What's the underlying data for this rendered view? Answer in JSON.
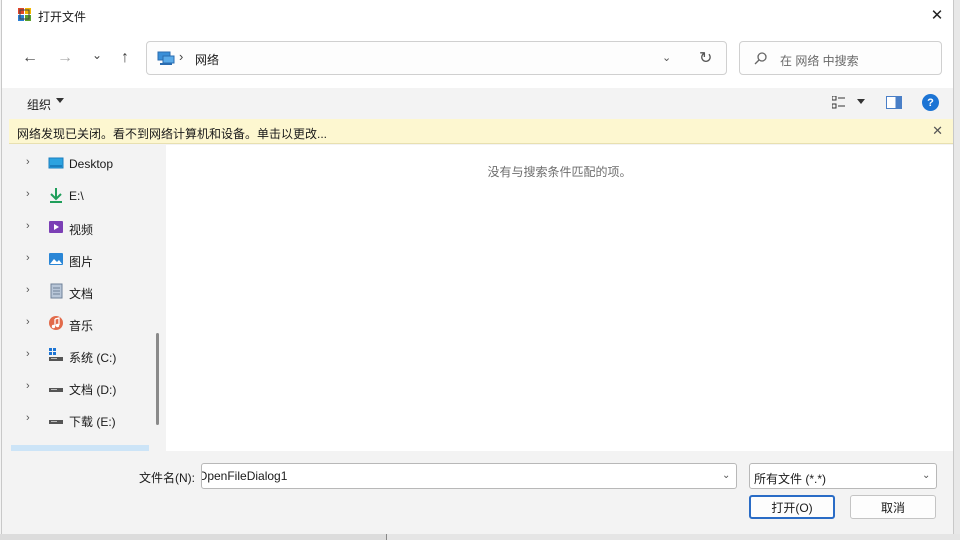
{
  "window": {
    "title": "打开文件",
    "close_glyph": "✕"
  },
  "nav": {
    "back_glyph": "←",
    "forward_glyph": "→",
    "recent_glyph": "⌄",
    "up_glyph": "↑",
    "address_sep": "›",
    "address_text": "网络",
    "address_dropdown_glyph": "⌄",
    "refresh_glyph": "↻",
    "search_placeholder": "在 网络 中搜索"
  },
  "toolbar": {
    "organize_label": "组织",
    "help_glyph": "?"
  },
  "infobar": {
    "text": "网络发现已关闭。看不到网络计算机和设备。单击以更改...",
    "close_glyph": "✕"
  },
  "sidebar": {
    "items": [
      {
        "label": "Desktop",
        "icon": "desktop-icon",
        "chevron": "›"
      },
      {
        "label": "E:\\",
        "icon": "download-arrow-icon",
        "chevron": "›"
      },
      {
        "label": "视频",
        "icon": "video-icon",
        "chevron": "›"
      },
      {
        "label": "图片",
        "icon": "pictures-icon",
        "chevron": "›"
      },
      {
        "label": "文档",
        "icon": "documents-icon",
        "chevron": "›"
      },
      {
        "label": "音乐",
        "icon": "music-icon",
        "chevron": "›"
      },
      {
        "label": "系统 (C:)",
        "icon": "system-drive-icon",
        "chevron": "›"
      },
      {
        "label": "文档 (D:)",
        "icon": "drive-icon",
        "chevron": "›"
      },
      {
        "label": "下载 (E:)",
        "icon": "drive-icon",
        "chevron": "›"
      }
    ]
  },
  "content": {
    "empty_message": "没有与搜索条件匹配的项。"
  },
  "bottom": {
    "filename_label": "文件名(N):",
    "filename_value": "OpenFileDialog1",
    "filetype_value": "所有文件 (*.*)",
    "dropdown_glyph": "⌄",
    "open_label": "打开(O)",
    "cancel_label": "取消"
  },
  "colors": {
    "accent": "#2a6cc6",
    "infobar_bg": "#fdf7d0",
    "help_blue": "#1c74d4"
  }
}
